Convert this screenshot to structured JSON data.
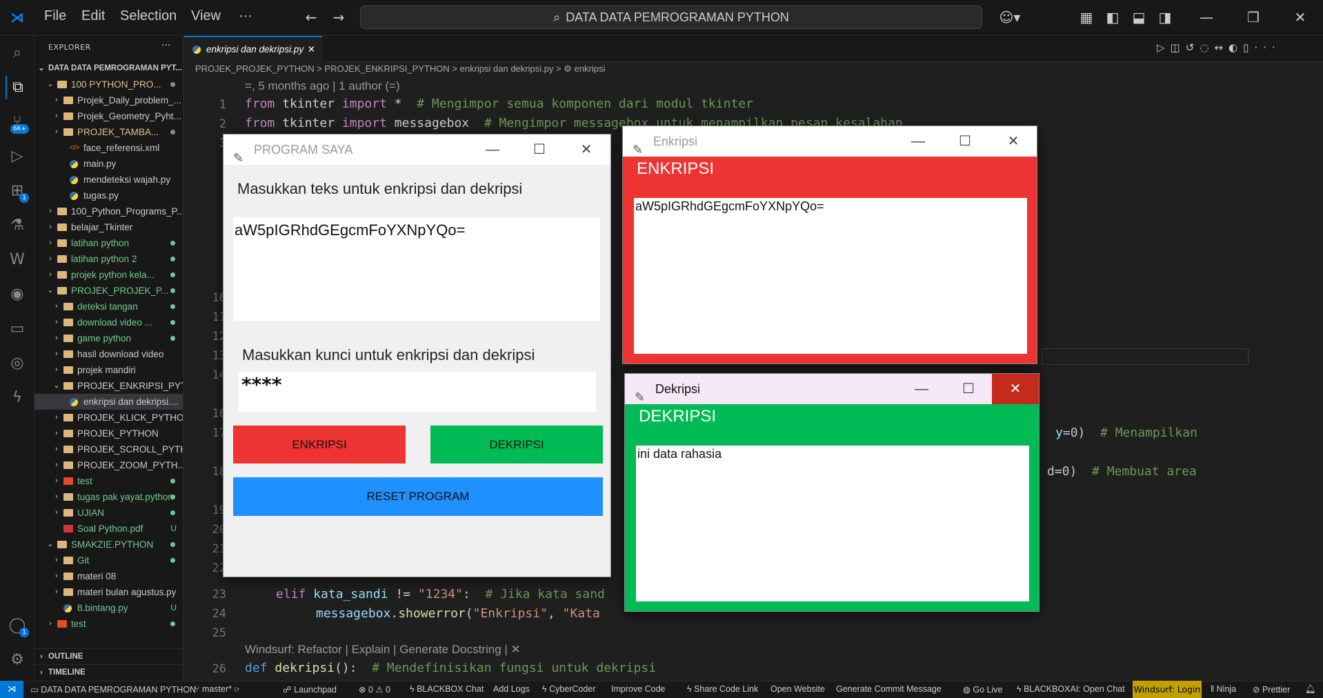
{
  "titlebar": {
    "menu": [
      "File",
      "Edit",
      "Selection",
      "View",
      "···"
    ],
    "search": "DATA DATA PEMROGRAMAN PYTHON"
  },
  "explorer": {
    "header": "EXPLORER",
    "root": "DATA DATA PEMROGRAMAN PYT...",
    "items": [
      {
        "label": "100 PYTHON_PRO...",
        "color": "#e2c08d",
        "dot": "#8b8b8b",
        "kind": "folder",
        "open": true,
        "indent": 1
      },
      {
        "label": "Projek_Daily_problem_...",
        "color": "#cccccc",
        "kind": "folder",
        "indent": 2
      },
      {
        "label": "Projek_Geometry_Pyht...",
        "color": "#cccccc",
        "kind": "folder",
        "indent": 2
      },
      {
        "label": "PROJEK_TAMBA...",
        "color": "#e2c08d",
        "dot": "#8b8b8b",
        "kind": "folder",
        "indent": 2
      },
      {
        "label": "face_referensi.xml",
        "color": "#cccccc",
        "kind": "xml",
        "indent": 3
      },
      {
        "label": "main.py",
        "color": "#cccccc",
        "kind": "py",
        "indent": 3
      },
      {
        "label": "mendeteksi wajah.py",
        "color": "#cccccc",
        "kind": "py",
        "indent": 3
      },
      {
        "label": "tugas.py",
        "color": "#cccccc",
        "kind": "py",
        "indent": 3
      },
      {
        "label": "100_Python_Programs_P...",
        "color": "#cccccc",
        "kind": "folder",
        "indent": 1
      },
      {
        "label": "belajar_Tkinter",
        "color": "#cccccc",
        "kind": "folder",
        "indent": 1
      },
      {
        "label": "latihan python",
        "color": "#73c991",
        "dot": "#73c991",
        "kind": "folder",
        "indent": 1
      },
      {
        "label": "latihan python 2",
        "color": "#73c991",
        "dot": "#73c991",
        "kind": "folder",
        "indent": 1
      },
      {
        "label": "projek python kela...",
        "color": "#73c991",
        "dot": "#73c991",
        "kind": "folder",
        "indent": 1
      },
      {
        "label": "PROJEK_PROJEK_P...",
        "color": "#73c991",
        "dot": "#73c991",
        "kind": "folder",
        "open": true,
        "indent": 1
      },
      {
        "label": "deteksi tangan",
        "color": "#73c991",
        "dot": "#73c991",
        "kind": "folder",
        "indent": 2
      },
      {
        "label": "download video ...",
        "color": "#73c991",
        "dot": "#73c991",
        "kind": "folder",
        "indent": 2
      },
      {
        "label": "game python",
        "color": "#73c991",
        "dot": "#73c991",
        "kind": "folder",
        "indent": 2
      },
      {
        "label": "hasil download video",
        "color": "#cccccc",
        "kind": "folder",
        "indent": 2
      },
      {
        "label": "projek mandiri",
        "color": "#cccccc",
        "kind": "folder",
        "indent": 2
      },
      {
        "label": "PROJEK_ENKRIPSI_PYT...",
        "color": "#cccccc",
        "kind": "folder",
        "open": true,
        "indent": 2
      },
      {
        "label": "enkripsi dan dekripsi....",
        "color": "#cccccc",
        "kind": "py",
        "indent": 3,
        "selected": true
      },
      {
        "label": "PROJEK_KLICK_PYTHON",
        "color": "#cccccc",
        "kind": "folder",
        "indent": 2
      },
      {
        "label": "PROJEK_PYTHON",
        "color": "#cccccc",
        "kind": "folder",
        "indent": 2
      },
      {
        "label": "PROJEK_SCROLL_PYTH...",
        "color": "#cccccc",
        "kind": "folder",
        "indent": 2
      },
      {
        "label": "PROJEK_ZOOM_PYTH...",
        "color": "#cccccc",
        "kind": "folder",
        "indent": 2
      },
      {
        "label": "test",
        "color": "#73c991",
        "dot": "#73c991",
        "kind": "git",
        "indent": 2
      },
      {
        "label": "tugas pak yayat.python",
        "color": "#73c991",
        "dot": "#73c991",
        "kind": "folder",
        "indent": 2
      },
      {
        "label": "UJIAN",
        "color": "#73c991",
        "dot": "#73c991",
        "kind": "folder",
        "indent": 2
      },
      {
        "label": "Soal Python.pdf",
        "color": "#73c991",
        "u": "U",
        "kind": "pdf",
        "indent": 2
      },
      {
        "label": "SMAKZIE.PYTHON",
        "color": "#73c991",
        "dot": "#73c991",
        "kind": "folder",
        "open": true,
        "indent": 1
      },
      {
        "label": "Git",
        "color": "#73c991",
        "dot": "#73c991",
        "kind": "folder",
        "indent": 2
      },
      {
        "label": "materi 08",
        "color": "#cccccc",
        "kind": "folder",
        "indent": 2
      },
      {
        "label": "materi bulan agustus.py",
        "color": "#cccccc",
        "kind": "folder",
        "indent": 2
      },
      {
        "label": "8.bintang.py",
        "color": "#73c991",
        "u": "U",
        "kind": "py",
        "indent": 2
      },
      {
        "label": "test",
        "color": "#73c991",
        "dot": "#73c991",
        "kind": "git",
        "indent": 1
      }
    ],
    "outline": "OUTLINE",
    "timeline": "TIMELINE"
  },
  "editor": {
    "tab": "enkripsi dan dekripsi.py",
    "breadcrumbs": "PROJEK_PROJEK_PYTHON > PROJEK_ENKRIPSI_PYTHON > enkripsi dan dekripsi.py > ⚙ enkripsi",
    "blame": "=, 5 months ago | 1 author (=)",
    "lens": "Windsurf: Refactor | Explain | Generate Docstring | ✕",
    "line_numbers": [
      "1",
      "2",
      "3",
      "",
      "",
      "",
      "",
      "",
      "",
      "",
      "16",
      "11",
      "12",
      "13",
      "14",
      "",
      "16",
      "17",
      "",
      "18",
      "",
      "19",
      "20",
      "21",
      "22",
      "23",
      "24",
      "25",
      "",
      "26"
    ]
  },
  "tk_main": {
    "title": "PROGRAM SAYA",
    "label1": "Masukkan teks untuk enkripsi dan dekripsi",
    "text_value": "aW5pIGRhdGEgcmFoYXNpYQo=",
    "label2": "Masukkan kunci untuk enkripsi dan dekripsi",
    "key_value": "****",
    "btn_encrypt": "ENKRIPSI",
    "btn_decrypt": "DEKRIPSI",
    "btn_reset": "RESET PROGRAM"
  },
  "tk_enc": {
    "title": "Enkripsi",
    "header": "ENKRIPSI",
    "value": "aW5pIGRhdGEgcmFoYXNpYQo="
  },
  "tk_dec": {
    "title": "Dekripsi",
    "header": "DEKRIPSI",
    "value": "ini data rahasia"
  },
  "status": {
    "workspace": "DATA DATA PEMROGRAMAN PYTHON",
    "branch": "master*",
    "launchpad": "Launchpad",
    "problems": "0 ⚠ 0",
    "blackbox": "BLACKBOX Chat",
    "addlogs": "Add Logs",
    "cybercoder": "CyberCoder",
    "improve": "Improve Code",
    "share": "Share Code Link",
    "website": "Open Website",
    "commit": "Generate Commit Message",
    "golive": "Go Live",
    "bbai": "BLACKBOXAI: Open Chat",
    "windsurf": "Windsurf: Login",
    "ninja": "Ninja",
    "prettier": "Prettier"
  },
  "colors": {
    "enc_red": "#ee3333",
    "dec_green": "#00bb55",
    "reset_blue": "#1e90ff",
    "accent": "#0078d4"
  }
}
